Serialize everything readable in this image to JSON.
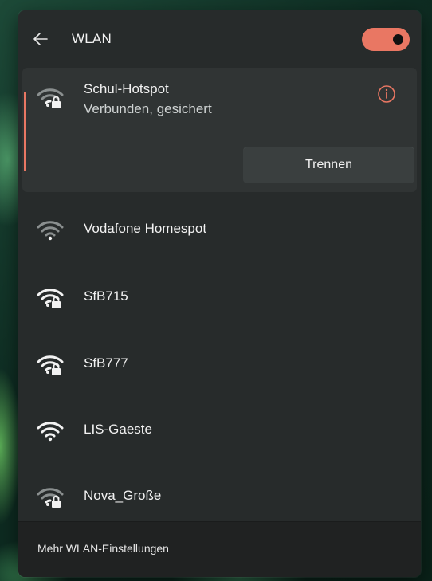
{
  "header": {
    "back_icon": "arrow-left-icon",
    "title": "WLAN",
    "toggle_state": "on",
    "accent_color": "#e97763"
  },
  "connected_network": {
    "name": "Schul-Hotspot",
    "status": "Verbunden, gesichert",
    "icon": "wifi-secured-icon",
    "info_icon": "info-icon",
    "disconnect_label": "Trennen"
  },
  "networks": [
    {
      "name": "Vodafone Homespot",
      "icon": "wifi-weak-icon",
      "secured": false
    },
    {
      "name": "SfB715",
      "icon": "wifi-secured-icon",
      "secured": true
    },
    {
      "name": "SfB777",
      "icon": "wifi-secured-icon",
      "secured": true
    },
    {
      "name": "LIS-Gaeste",
      "icon": "wifi-full-icon",
      "secured": false
    },
    {
      "name": "Nova_Große",
      "icon": "wifi-secured-weak-icon",
      "secured": true
    }
  ],
  "footer": {
    "settings_link": "Mehr WLAN-Einstellungen"
  }
}
